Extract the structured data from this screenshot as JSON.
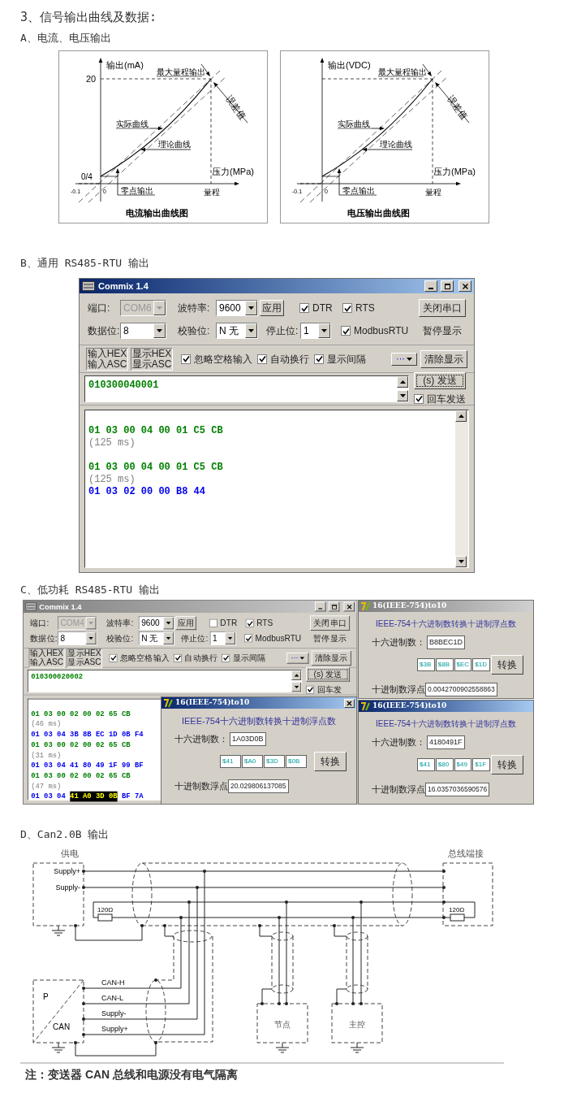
{
  "heading": "3、信号输出曲线及数据:",
  "section_a": {
    "title": "A、电流、电压输出",
    "charts": [
      {
        "y_axis_label": "输出(mA)",
        "y_max": "20",
        "y_origin": "0/4",
        "x_axis_label": "压力(MPa)",
        "x_min": "-0.1",
        "x_zero": "0",
        "x_full": "量程",
        "max_output_label": "最大量程输出",
        "error_label": "误差值",
        "actual_curve_label": "实际曲线",
        "theory_curve_label": "理论曲线",
        "zero_output_label": "零点输出",
        "caption": "电流输出曲线图"
      },
      {
        "y_axis_label": "输出(VDC)",
        "x_axis_label": "压力(MPa)",
        "x_min": "-0.1",
        "x_zero": "0",
        "x_full": "量程",
        "max_output_label": "最大量程输出",
        "error_label": "误差值",
        "actual_curve_label": "实际曲线",
        "theory_curve_label": "理论曲线",
        "zero_output_label": "零点输出",
        "caption": "电压输出曲线图"
      }
    ]
  },
  "section_b": {
    "title": "B、通用 RS485-RTU 输出",
    "window": {
      "title": "Commix 1.4",
      "active": true,
      "port": {
        "label": "端口:",
        "value": "COM6",
        "disabled": true
      },
      "baud_rate": {
        "label": "波特率:",
        "value": "9600",
        "disabled": false
      },
      "apply_button": "应用",
      "dtr": {
        "label": "DTR",
        "checked": true
      },
      "rts": {
        "label": "RTS",
        "checked": true
      },
      "close_port_button": "关闭串口",
      "data_bits": {
        "label": "数据位:",
        "value": "8",
        "disabled": false
      },
      "parity": {
        "label": "校验位:",
        "value": "N 无",
        "disabled": false
      },
      "stop_bits": {
        "label": "停止位:",
        "value": "1",
        "disabled": false
      },
      "modbus_rtu": {
        "label": "ModbusRTU",
        "checked": true
      },
      "pause_button": "暂停显示",
      "mode_toggles": [
        {
          "top": "输入HEX",
          "bottom": "输入ASC"
        },
        {
          "top": "显示HEX",
          "bottom": "显示ASC"
        }
      ],
      "options": [
        {
          "label": "忽略空格输入",
          "checked": true
        },
        {
          "label": "自动换行",
          "checked": true
        },
        {
          "label": "显示间隔",
          "checked": true
        }
      ],
      "more_button": "···",
      "clear_button": "清除显示",
      "input": "010300040001",
      "send_button": "(s) 发送",
      "enter_send": {
        "label": "回车发送",
        "checked": true
      },
      "output": [
        {
          "kind": "sent",
          "text": "01 03 00 04 00 01 C5 CB"
        },
        {
          "kind": "time",
          "text": "(125 ms)"
        },
        {
          "kind": "blank"
        },
        {
          "kind": "sent",
          "text": "01 03 00 04 00 01 C5 CB"
        },
        {
          "kind": "time",
          "text": "(125 ms)"
        },
        {
          "kind": "recv",
          "text": "01 03 02 00 00 B8 44"
        }
      ]
    }
  },
  "section_c": {
    "title": "C、低功耗 RS485-RTU 输出",
    "window": {
      "title": "Commix 1.4",
      "active": false,
      "port": {
        "label": "端口:",
        "value": "COM4",
        "disabled": true
      },
      "baud_rate": {
        "label": "波特率:",
        "value": "9600",
        "disabled": false
      },
      "apply_button": "应用",
      "dtr": {
        "label": "DTR",
        "checked": false
      },
      "rts": {
        "label": "RTS",
        "checked": true
      },
      "close_port_button": "关闭串口",
      "data_bits": {
        "label": "数据位:",
        "value": "8",
        "disabled": false
      },
      "parity": {
        "label": "校验位:",
        "value": "N 无",
        "disabled": false
      },
      "stop_bits": {
        "label": "停止位:",
        "value": "1",
        "disabled": false
      },
      "modbus_rtu": {
        "label": "ModbusRTU",
        "checked": true
      },
      "pause_button": "暂停显示",
      "mode_toggles": [
        {
          "top": "输入HEX",
          "bottom": "输入ASC"
        },
        {
          "top": "显示HEX",
          "bottom": "显示ASC"
        }
      ],
      "options": [
        {
          "label": "忽略空格输入",
          "checked": true
        },
        {
          "label": "自动换行",
          "checked": true
        },
        {
          "label": "显示间隔",
          "checked": true
        }
      ],
      "more_button": "···",
      "clear_button": "清除显示",
      "input": "010300020002",
      "send_button": "(s) 发送",
      "enter_send": {
        "label": "回车发",
        "checked": true
      },
      "output": [
        {
          "kind": "sent",
          "text": "01 03 00 02 00 02 65 CB"
        },
        {
          "kind": "time",
          "text": "(46 ms)"
        },
        {
          "kind": "recv",
          "text": "01 03 04 3B 8B EC 1D 0B F4"
        },
        {
          "kind": "sent",
          "text": "01 03 00 02 00 02 65 CB"
        },
        {
          "kind": "time",
          "text": "(31 ms)"
        },
        {
          "kind": "recv",
          "text": "01 03 04 41 80 49 1F 99 BF"
        },
        {
          "kind": "sent",
          "text": "01 03 00 02 00 02 65 CB"
        },
        {
          "kind": "time",
          "text": "(47 ms)"
        },
        {
          "kind": "recv",
          "segments": [
            {
              "text": "01 03 04",
              "highlighted": false
            },
            {
              "text": "41 A0 3D 0B",
              "highlighted": true
            },
            {
              "text": "BF 7A",
              "highlighted": false
            }
          ]
        }
      ]
    },
    "converters": [
      {
        "title": "16(IEEE-754)to10",
        "active": true,
        "heading": "IEEE-754十六进制数转换十进制浮点数",
        "hex_label": "十六进制数：",
        "hex_value": "1A03D0B",
        "bytes": [
          "$41",
          "$A0",
          "$3D",
          "$0B"
        ],
        "convert_button": "转换",
        "float_label": "十进制数浮点",
        "float_value": "20.029806137085"
      },
      {
        "title": "16(IEEE-754)to10",
        "active": false,
        "heading": "IEEE-754十六进制数转换十进制浮点数",
        "hex_label": "十六进制数：",
        "hex_value": "B8BEC1D",
        "bytes": [
          "$3B",
          "$8B",
          "$EC",
          "$1D"
        ],
        "convert_button": "转换",
        "float_label": "十进制数浮点",
        "float_value": "0.0042700902558863"
      },
      {
        "title": "16(IEEE-754)to10",
        "active": true,
        "heading": "IEEE-754十六进制数转换十进制浮点数",
        "hex_label": "十六进制数：",
        "hex_value": "4180491F",
        "bytes": [
          "$41",
          "$80",
          "$49",
          "$1F"
        ],
        "convert_button": "转换",
        "float_label": "十进制数浮点",
        "float_value": "16.0357036590576"
      }
    ]
  },
  "section_d": {
    "title": "D、Can2.0B 输出",
    "diagram": {
      "power_label": "供电",
      "power_terminals": [
        "Supply+",
        "Supply-"
      ],
      "termination_label": "总线端接",
      "resistor_labels": [
        "120Ω",
        "120Ω"
      ],
      "sensor_labels": [
        "P",
        "CAN"
      ],
      "sensor_lines": [
        "CAN-H",
        "CAN-L",
        "Supply-",
        "Supply+"
      ],
      "node_label": "节点",
      "master_label": "主控"
    },
    "note": "注：变送器 CAN 总线和电源没有电气隔离"
  }
}
